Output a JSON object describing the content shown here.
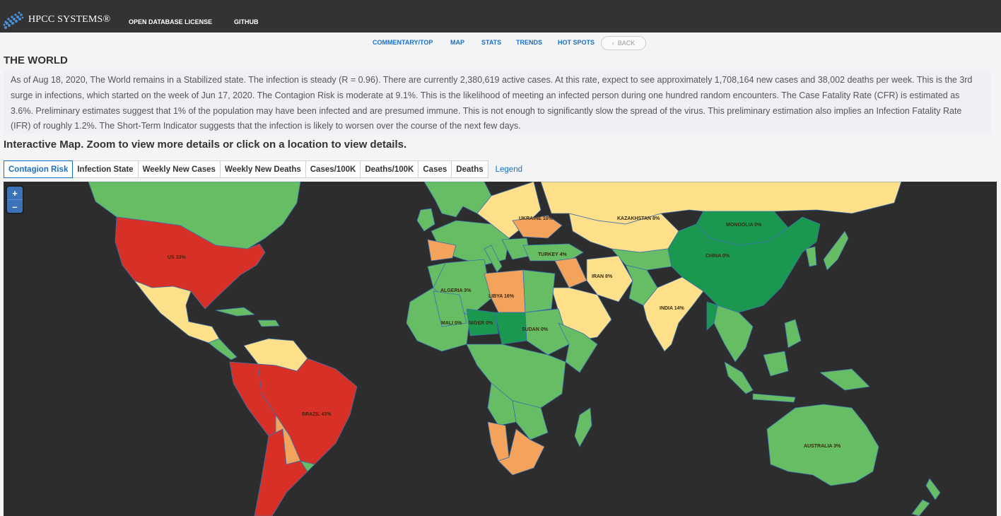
{
  "header": {
    "logo_text": "HPCC SYSTEMS®",
    "links": [
      "OPEN DATABASE LICENSE",
      "GITHUB"
    ]
  },
  "subnav": {
    "items": [
      "COMMENTARY/TOP",
      "MAP",
      "STATS",
      "TRENDS",
      "HOT SPOTS"
    ],
    "back_label": "BACK"
  },
  "page": {
    "title": "THE WORLD",
    "summary": "As of Aug 18, 2020, The World remains in a Stabilized state. The infection is steady (R = 0.96). There are currently 2,380,619 active cases. At this rate, expect to see approximately 1,708,164 new cases and 38,002 deaths per week. This is the 3rd surge in infections, which started on the week of Jun 17, 2020. The Contagion Risk is moderate at 9.1%. This is the likelihood of meeting an infected person during one hundred random encounters. The Case Fatality Rate (CFR) is estimated as 3.6%. Preliminary estimates suggest that 1% of the population may have been infected and are presumed immune. This is not enough to significantly slow the spread of the virus. This preliminary estimation also implies an Infection Fatality Rate (IFR) of roughly 1.2%. The Short-Term Indicator suggests that the infection is likely to worsen over the course of the next few days.",
    "map_heading": "Interactive Map. Zoom to view more details or click on a location to view details."
  },
  "tabs": [
    "Contagion Risk",
    "Infection State",
    "Weekly New Cases",
    "Weekly New Deaths",
    "Cases/100K",
    "Deaths/100K",
    "Cases",
    "Deaths"
  ],
  "active_tab": "Contagion Risk",
  "legend_label": "Legend",
  "zoom": {
    "in": "+",
    "out": "–"
  },
  "map_labels": {
    "us": "US 33%",
    "brazil": "BRAZIL 43%",
    "ukraine": "UKRAINE 10%",
    "kazakhstan": "KAZAKHSTAN 8%",
    "mongolia": "MONGOLIA 0%",
    "china": "CHINA 0%",
    "turkey": "TURKEY 4%",
    "iran": "IRAN 8%",
    "india": "INDIA 14%",
    "algeria": "ALGERIA 3%",
    "libya": "LIBYA 16%",
    "mali": "MALI 0%",
    "niger": "NIGER 0%",
    "sudan": "SUDAN 0%",
    "australia": "AUSTRALIA 3%"
  },
  "colors": {
    "ocean": "#2d2d2d",
    "very_high": "#d73027",
    "high": "#f4a35c",
    "moderate": "#fee08b",
    "low": "#66bd63",
    "very_low": "#1a9850",
    "accent": "#1a6fc4"
  }
}
